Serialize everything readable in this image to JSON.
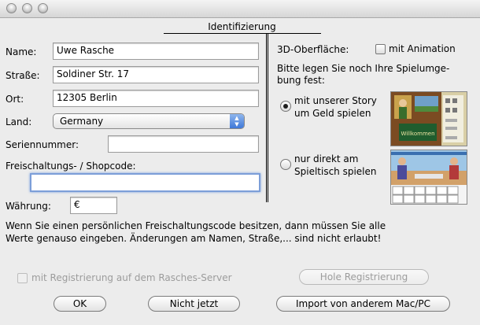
{
  "window": {
    "title": ""
  },
  "section_title": "Identifizierung",
  "form": {
    "name_label": "Name:",
    "name_value": "Uwe Rasche",
    "street_label": "Straße:",
    "street_value": "Soldiner Str. 17",
    "city_label": "Ort:",
    "city_value": "12305 Berlin",
    "country_label": "Land:",
    "country_value": "Germany",
    "serial_label": "Seriennummer:",
    "serial_value": "",
    "code_label": "Freischaltungs- / Shopcode:",
    "code_value": "",
    "currency_label": "Währung:",
    "currency_value": "€"
  },
  "right": {
    "surface_label": "3D-Oberfläche:",
    "animation_label": "mit Animation",
    "animation_checked": false,
    "env_prompt_line1": "Bitte legen Sie noch Ihre Spielumge-",
    "env_prompt_line2": "bung fest:",
    "option_story_line1": "mit unserer Story",
    "option_story_line2": "um Geld spielen",
    "option_table_line1": "nur direkt am",
    "option_table_line2": "Spieltisch spielen",
    "selected_option": "story"
  },
  "info": {
    "line1": "Wenn Sie einen persönlichen Freischaltungscode besitzen, dann müssen Sie alle",
    "line2": "Werte genauso eingeben.  Änderungen am Namen, Straße,... sind nicht erlaubt!"
  },
  "server": {
    "checkbox_label": "mit Registrierung auf dem Rasches-Server",
    "fetch_button": "Hole Registrierung"
  },
  "buttons": {
    "ok": "OK",
    "not_now": "Nicht jetzt",
    "import": "Import von anderem Mac/PC"
  },
  "colors": {
    "window_bg": "#ececec",
    "focus_ring": "#7c9ed8",
    "popup_accent": "#3f78d8"
  }
}
